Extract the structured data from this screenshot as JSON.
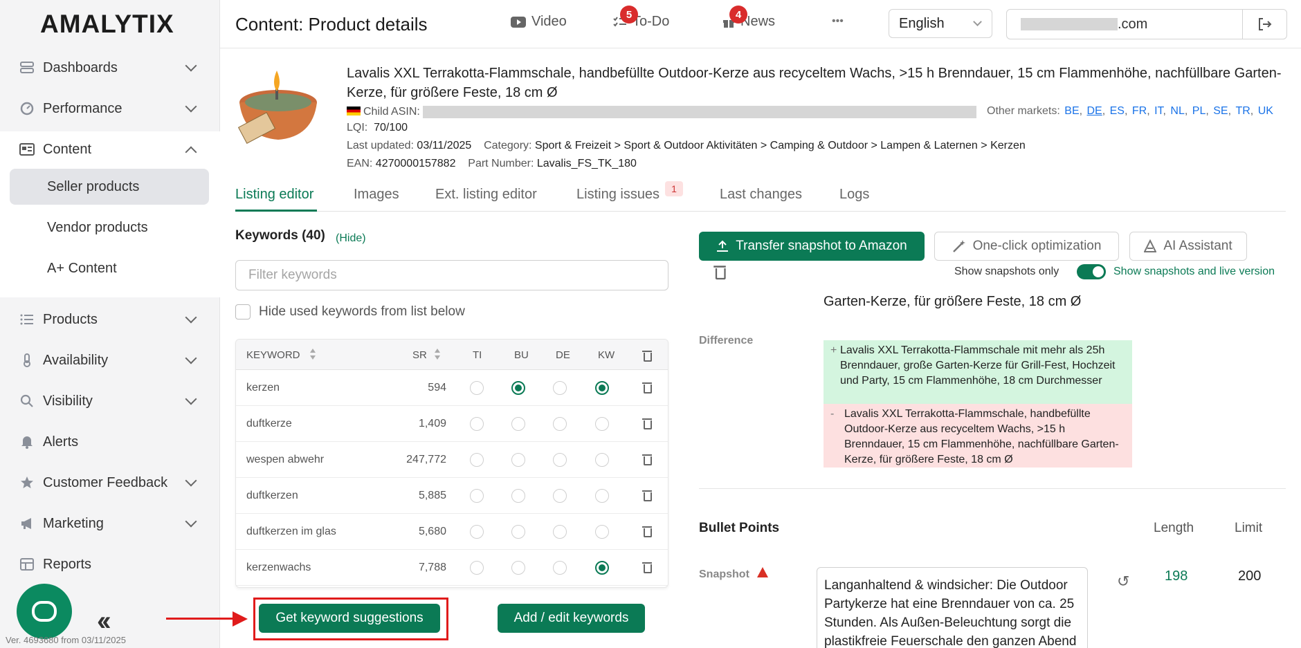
{
  "app": {
    "logo": "AMALYTIX",
    "version": "Ver. 4693680 from 03/11/2025"
  },
  "sidebar": {
    "items": [
      {
        "label": "Dashboards"
      },
      {
        "label": "Performance"
      },
      {
        "label": "Content"
      },
      {
        "label": "Products"
      },
      {
        "label": "Availability"
      },
      {
        "label": "Visibility"
      },
      {
        "label": "Alerts"
      },
      {
        "label": "Customer Feedback"
      },
      {
        "label": "Marketing"
      },
      {
        "label": "Reports"
      }
    ],
    "content_sub": [
      {
        "label": "Seller products"
      },
      {
        "label": "Vendor products"
      },
      {
        "label": "A+ Content"
      }
    ]
  },
  "header": {
    "title": "Content: Product details",
    "video": "Video",
    "todo": "To-Do",
    "todo_count": "5",
    "news": "News",
    "news_count": "4",
    "more": "•••",
    "language": "English",
    "account_domain": ".com"
  },
  "product": {
    "title": "Lavalis XXL Terrakotta-Flammschale, handbefüllte Outdoor-Kerze aus recyceltem Wachs, >15 h Brenndauer, 15 cm Flammenhöhe, nachfüllbare Garten-Kerze, für größere Feste, 18 cm Ø",
    "child_asin_label": "Child ASIN:",
    "other_markets_label": "Other markets:",
    "markets": [
      "BE",
      "DE",
      "ES",
      "FR",
      "IT",
      "NL",
      "PL",
      "SE",
      "TR",
      "UK"
    ],
    "lqi_label": "LQI:",
    "lqi": "70/100",
    "last_updated_label": "Last updated:",
    "last_updated": "03/11/2025",
    "category_label": "Category:",
    "category": "Sport & Freizeit > Sport & Outdoor Aktivitäten > Camping & Outdoor > Lampen & Laternen > Kerzen",
    "ean_label": "EAN:",
    "ean": "4270000157882",
    "part_label": "Part Number:",
    "part": "Lavalis_FS_TK_180"
  },
  "tabs": [
    {
      "label": "Listing editor"
    },
    {
      "label": "Images"
    },
    {
      "label": "Ext. listing editor"
    },
    {
      "label": "Listing issues",
      "badge": "1"
    },
    {
      "label": "Last changes"
    },
    {
      "label": "Logs"
    }
  ],
  "keywords": {
    "title": "Keywords (40)",
    "hide": "(Hide)",
    "filter_placeholder": "Filter keywords",
    "hide_used_label": "Hide used keywords from list below",
    "columns": [
      "KEYWORD",
      "SR",
      "TI",
      "BU",
      "DE",
      "KW"
    ],
    "rows": [
      {
        "keyword": "kerzen",
        "sr": "594",
        "ti": false,
        "bu": true,
        "de": false,
        "kw": true
      },
      {
        "keyword": "duftkerze",
        "sr": "1,409",
        "ti": false,
        "bu": false,
        "de": false,
        "kw": false
      },
      {
        "keyword": "wespen abwehr",
        "sr": "247,772",
        "ti": false,
        "bu": false,
        "de": false,
        "kw": false
      },
      {
        "keyword": "duftkerzen",
        "sr": "5,885",
        "ti": false,
        "bu": false,
        "de": false,
        "kw": false
      },
      {
        "keyword": "duftkerzen im glas",
        "sr": "5,680",
        "ti": false,
        "bu": false,
        "de": false,
        "kw": false
      },
      {
        "keyword": "kerzenwachs",
        "sr": "7,788",
        "ti": false,
        "bu": false,
        "de": false,
        "kw": true
      }
    ],
    "suggest_btn": "Get keyword suggestions",
    "add_btn": "Add / edit keywords"
  },
  "editor": {
    "transfer_btn": "Transfer snapshot to Amazon",
    "optimize_btn": "One-click optimization",
    "ai_btn": "AI Assistant",
    "show_snapshots_only": "Show snapshots only",
    "show_both": "Show snapshots and live version",
    "prev_line": "Garten-Kerze, für größere Feste, 18 cm Ø",
    "difference_label": "Difference",
    "diff_add": "Lavalis XXL Terrakotta-Flammschale mit mehr als 25h Brenndauer, große Garten-Kerze für Grill-Fest, Hochzeit und Party, 15 cm Flammenhöhe, 18 cm Durchmesser",
    "diff_del": "Lavalis XXL Terrakotta-Flammschale, handbefüllte Outdoor-Kerze aus recyceltem Wachs, >15 h Brenndauer, 15 cm Flammenhöhe, nachfüllbare Garten-Kerze, für größere Feste, 18 cm Ø",
    "bullet_title": "Bullet Points",
    "length_col": "Length",
    "limit_col": "Limit",
    "snapshot_label": "Snapshot",
    "bullet_text": "Langanhaltend & windsicher: Die Outdoor Partykerze hat eine Brenndauer von ca. 25 Stunden. Als Außen-Beleuchtung sorgt die plastikfreie Feuerschale den ganzen Abend",
    "length": "198",
    "limit": "200"
  },
  "colors": {
    "accent": "#0b7a55",
    "badge": "#d92c2c",
    "annotation": "#e01b1b"
  }
}
